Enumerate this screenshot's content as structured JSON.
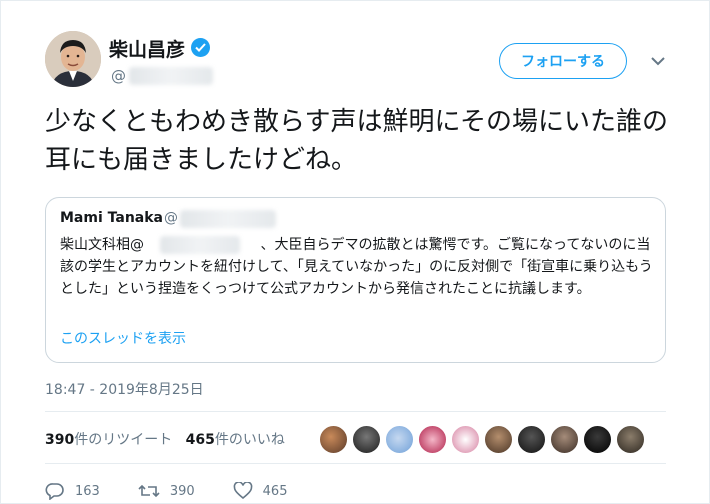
{
  "header": {
    "display_name": "柴山昌彦",
    "handle_prefix": "@",
    "follow_label": "フォローする"
  },
  "tweet": {
    "text": "少なくともわめき散らす声は鮮明にその場にいた誰の耳にも届きましたけどね。",
    "timestamp": "18:47 - 2019年8月25日"
  },
  "quote": {
    "author_name": "Mami Tanaka",
    "author_at": "@",
    "body": "柴山文科相@　　　　　　　　 、大臣自らデマの拡散とは驚愕です。ご覧になってないのに当該の学生とアカウントを紐付けして、「見えていなかった」のに反対側で「街宣車に乗り込もうとした」という捏造をくっつけて公式アカウントから発信されたことに抗議します。",
    "thread_link": "このスレッドを表示"
  },
  "stats": {
    "retweet_count": "390",
    "retweet_label": "件のリツイート",
    "like_count": "465",
    "like_label": "件のいいね"
  },
  "actions": {
    "reply_count": "163",
    "retweet_count": "390",
    "like_count": "465"
  },
  "icons": {
    "verified": "verified-badge-icon",
    "caret": "chevron-down-icon",
    "reply": "reply-icon",
    "retweet": "retweet-icon",
    "like": "heart-icon"
  },
  "colors": {
    "accent": "#1da1f2",
    "secondary_text": "#657786",
    "border": "#ccd6dd"
  }
}
